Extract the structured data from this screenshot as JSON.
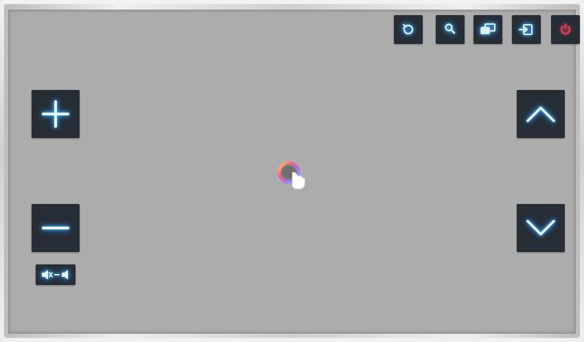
{
  "colors": {
    "screen_bg": "#acacac",
    "tile_bg": "#262d35",
    "icon_glow": "#49b7ff",
    "icon_line": "#dff3ff",
    "power_red": "#e23b57"
  },
  "toolbar": {
    "buttons": [
      {
        "icon": "refresh-icon"
      },
      {
        "icon": "search-icon"
      },
      {
        "icon": "screens-icon"
      },
      {
        "icon": "input-source-icon"
      },
      {
        "icon": "power-icon"
      }
    ]
  },
  "left_controls": {
    "volume_up_icon": "plus-icon",
    "volume_down_icon": "minus-icon",
    "mute_icon": "mute-toggle-icon"
  },
  "right_controls": {
    "channel_up_icon": "chevron-up-icon",
    "channel_down_icon": "chevron-down-icon"
  },
  "center": {
    "pointer_icon": "hand-pointer-icon"
  }
}
